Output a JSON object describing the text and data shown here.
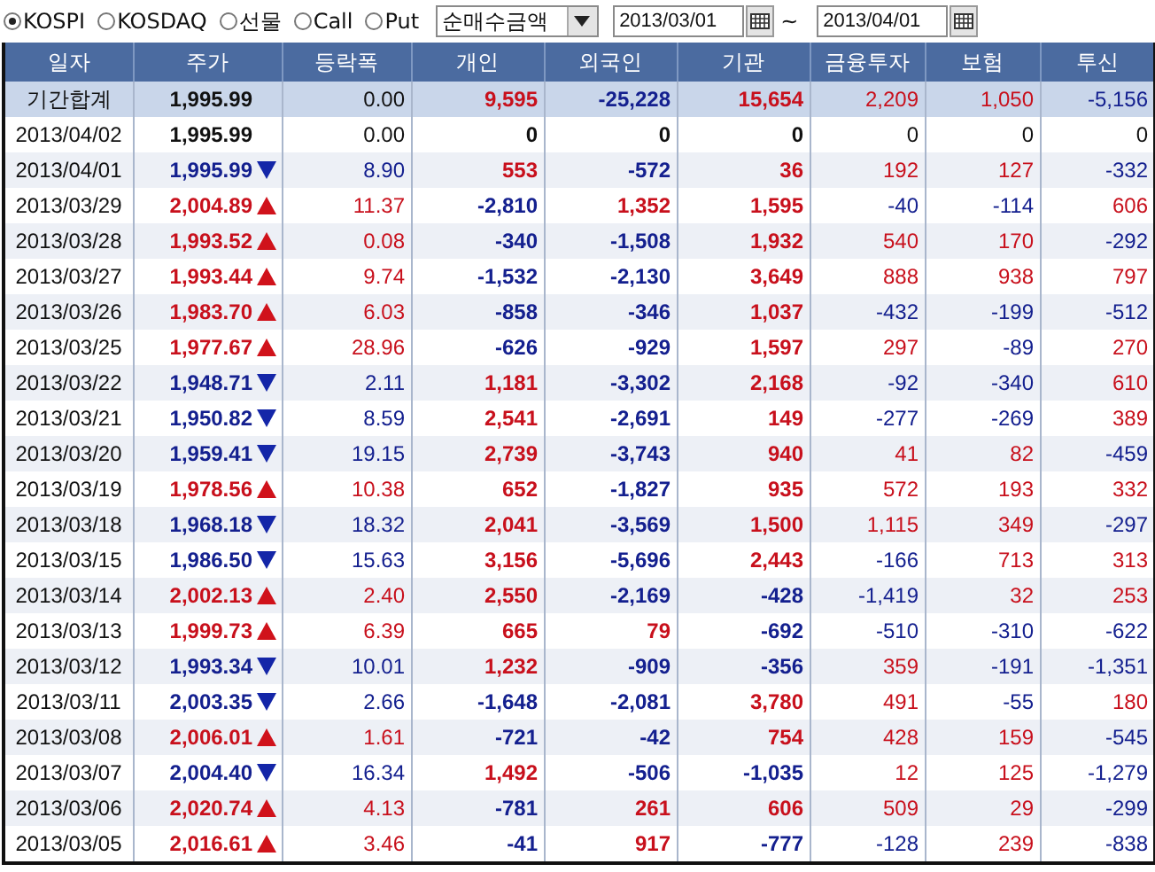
{
  "markets": [
    {
      "label": "KOSPI",
      "selected": true
    },
    {
      "label": "KOSDAQ",
      "selected": false
    },
    {
      "label": "선물",
      "selected": false
    },
    {
      "label": "Call",
      "selected": false
    },
    {
      "label": "Put",
      "selected": false
    }
  ],
  "measure": {
    "value": "순매수금액"
  },
  "date_from": "2013/03/01",
  "range_sep": "~",
  "date_to": "2013/04/01",
  "columns": [
    "일자",
    "주가",
    "등락폭",
    "개인",
    "외국인",
    "기관",
    "금융투자",
    "보험",
    "투신"
  ],
  "rows": [
    {
      "kind": "summary",
      "date": "기간합계",
      "price": "1,995.99",
      "rising": false,
      "falling": false,
      "change": "0.00",
      "cols": [
        "9,595",
        "-25,228",
        "15,654",
        "2,209",
        "1,050",
        "-5,156"
      ]
    },
    {
      "kind": "day",
      "date": "2013/04/02",
      "price": "1,995.99",
      "rising": false,
      "falling": false,
      "change": "0.00",
      "cols": [
        "0",
        "0",
        "0",
        "0",
        "0",
        "0"
      ]
    },
    {
      "kind": "day",
      "date": "2013/04/01",
      "price": "1,995.99",
      "rising": false,
      "falling": true,
      "change": "8.90",
      "cols": [
        "553",
        "-572",
        "36",
        "192",
        "127",
        "-332"
      ]
    },
    {
      "kind": "day",
      "date": "2013/03/29",
      "price": "2,004.89",
      "rising": true,
      "falling": false,
      "change": "11.37",
      "cols": [
        "-2,810",
        "1,352",
        "1,595",
        "-40",
        "-114",
        "606"
      ]
    },
    {
      "kind": "day",
      "date": "2013/03/28",
      "price": "1,993.52",
      "rising": true,
      "falling": false,
      "change": "0.08",
      "cols": [
        "-340",
        "-1,508",
        "1,932",
        "540",
        "170",
        "-292"
      ]
    },
    {
      "kind": "day",
      "date": "2013/03/27",
      "price": "1,993.44",
      "rising": true,
      "falling": false,
      "change": "9.74",
      "cols": [
        "-1,532",
        "-2,130",
        "3,649",
        "888",
        "938",
        "797"
      ]
    },
    {
      "kind": "day",
      "date": "2013/03/26",
      "price": "1,983.70",
      "rising": true,
      "falling": false,
      "change": "6.03",
      "cols": [
        "-858",
        "-346",
        "1,037",
        "-432",
        "-199",
        "-512"
      ]
    },
    {
      "kind": "day",
      "date": "2013/03/25",
      "price": "1,977.67",
      "rising": true,
      "falling": false,
      "change": "28.96",
      "cols": [
        "-626",
        "-929",
        "1,597",
        "297",
        "-89",
        "270"
      ]
    },
    {
      "kind": "day",
      "date": "2013/03/22",
      "price": "1,948.71",
      "rising": false,
      "falling": true,
      "change": "2.11",
      "cols": [
        "1,181",
        "-3,302",
        "2,168",
        "-92",
        "-340",
        "610"
      ]
    },
    {
      "kind": "day",
      "date": "2013/03/21",
      "price": "1,950.82",
      "rising": false,
      "falling": true,
      "change": "8.59",
      "cols": [
        "2,541",
        "-2,691",
        "149",
        "-277",
        "-269",
        "389"
      ]
    },
    {
      "kind": "day",
      "date": "2013/03/20",
      "price": "1,959.41",
      "rising": false,
      "falling": true,
      "change": "19.15",
      "cols": [
        "2,739",
        "-3,743",
        "940",
        "41",
        "82",
        "-459"
      ]
    },
    {
      "kind": "day",
      "date": "2013/03/19",
      "price": "1,978.56",
      "rising": true,
      "falling": false,
      "change": "10.38",
      "cols": [
        "652",
        "-1,827",
        "935",
        "572",
        "193",
        "332"
      ]
    },
    {
      "kind": "day",
      "date": "2013/03/18",
      "price": "1,968.18",
      "rising": false,
      "falling": true,
      "change": "18.32",
      "cols": [
        "2,041",
        "-3,569",
        "1,500",
        "1,115",
        "349",
        "-297"
      ]
    },
    {
      "kind": "day",
      "date": "2013/03/15",
      "price": "1,986.50",
      "rising": false,
      "falling": true,
      "change": "15.63",
      "cols": [
        "3,156",
        "-5,696",
        "2,443",
        "-166",
        "713",
        "313"
      ]
    },
    {
      "kind": "day",
      "date": "2013/03/14",
      "price": "2,002.13",
      "rising": true,
      "falling": false,
      "change": "2.40",
      "cols": [
        "2,550",
        "-2,169",
        "-428",
        "-1,419",
        "32",
        "253"
      ]
    },
    {
      "kind": "day",
      "date": "2013/03/13",
      "price": "1,999.73",
      "rising": true,
      "falling": false,
      "change": "6.39",
      "cols": [
        "665",
        "79",
        "-692",
        "-510",
        "-310",
        "-622"
      ]
    },
    {
      "kind": "day",
      "date": "2013/03/12",
      "price": "1,993.34",
      "rising": false,
      "falling": true,
      "change": "10.01",
      "cols": [
        "1,232",
        "-909",
        "-356",
        "359",
        "-191",
        "-1,351"
      ]
    },
    {
      "kind": "day",
      "date": "2013/03/11",
      "price": "2,003.35",
      "rising": false,
      "falling": true,
      "change": "2.66",
      "cols": [
        "-1,648",
        "-2,081",
        "3,780",
        "491",
        "-55",
        "180"
      ]
    },
    {
      "kind": "day",
      "date": "2013/03/08",
      "price": "2,006.01",
      "rising": true,
      "falling": false,
      "change": "1.61",
      "cols": [
        "-721",
        "-42",
        "754",
        "428",
        "159",
        "-545"
      ]
    },
    {
      "kind": "day",
      "date": "2013/03/07",
      "price": "2,004.40",
      "rising": false,
      "falling": true,
      "change": "16.34",
      "cols": [
        "1,492",
        "-506",
        "-1,035",
        "12",
        "125",
        "-1,279"
      ]
    },
    {
      "kind": "day",
      "date": "2013/03/06",
      "price": "2,020.74",
      "rising": true,
      "falling": false,
      "change": "4.13",
      "cols": [
        "-781",
        "261",
        "606",
        "509",
        "29",
        "-299"
      ]
    },
    {
      "kind": "day",
      "date": "2013/03/05",
      "price": "2,016.61",
      "rising": true,
      "falling": false,
      "change": "3.46",
      "cols": [
        "-41",
        "917",
        "-777",
        "-128",
        "239",
        "-838"
      ]
    }
  ]
}
